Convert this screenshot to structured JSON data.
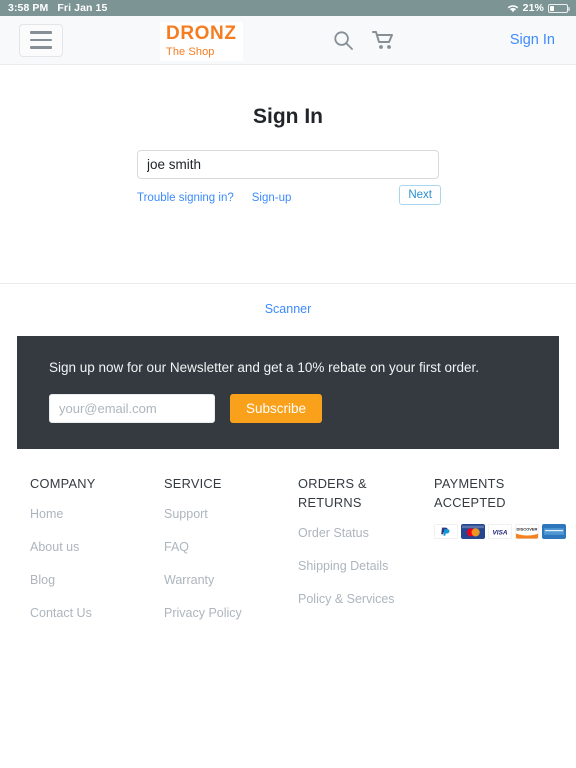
{
  "statusbar": {
    "time": "3:58 PM",
    "date": "Fri Jan 15",
    "battery": "21%",
    "wifi_icon": "wifi-icon",
    "battery_icon": "battery-icon"
  },
  "header": {
    "menu_icon": "hamburger-icon",
    "logo_main": "DRONZ",
    "logo_sub": "The Shop",
    "search_icon": "search-icon",
    "cart_icon": "shopping-cart-icon",
    "signin_label": "Sign In"
  },
  "main": {
    "title": "Sign In",
    "username_value": "joe smith",
    "username_placeholder": "",
    "trouble_link": "Trouble signing in?",
    "signup_link": "Sign-up",
    "next_label": "Next",
    "scanner_link": "Scanner"
  },
  "newsletter": {
    "message": "Sign up now for our Newsletter and get a 10% rebate on your first order.",
    "email_placeholder": "your@email.com",
    "email_value": "",
    "subscribe_label": "Subscribe",
    "background": "#343a40",
    "button_color": "#f9a11b"
  },
  "footer": {
    "columns": [
      {
        "heading": "COMPANY",
        "links": [
          "Home",
          "About us",
          "Blog",
          "Contact Us"
        ]
      },
      {
        "heading": "SERVICE",
        "links": [
          "Support",
          "FAQ",
          "Warranty",
          "Privacy Policy"
        ]
      },
      {
        "heading": "ORDERS & RETURNS",
        "links": [
          "Order Status",
          "Shipping Details",
          "Policy & Services"
        ]
      },
      {
        "heading": "PAYMENTS ACCEPTED",
        "links": []
      }
    ],
    "payments": [
      {
        "name": "paypal-icon",
        "label": "PayPal"
      },
      {
        "name": "mastercard-icon",
        "label": "MasterCard"
      },
      {
        "name": "visa-icon",
        "label": "VISA"
      },
      {
        "name": "discover-icon",
        "label": "DISCOVER"
      },
      {
        "name": "amex-icon",
        "label": "AmEx"
      }
    ]
  },
  "colors": {
    "brand_orange": "#f57c20",
    "link_blue": "#3d8bfd",
    "statusbar_bg": "#7d9495",
    "dark_panel": "#343a40"
  }
}
